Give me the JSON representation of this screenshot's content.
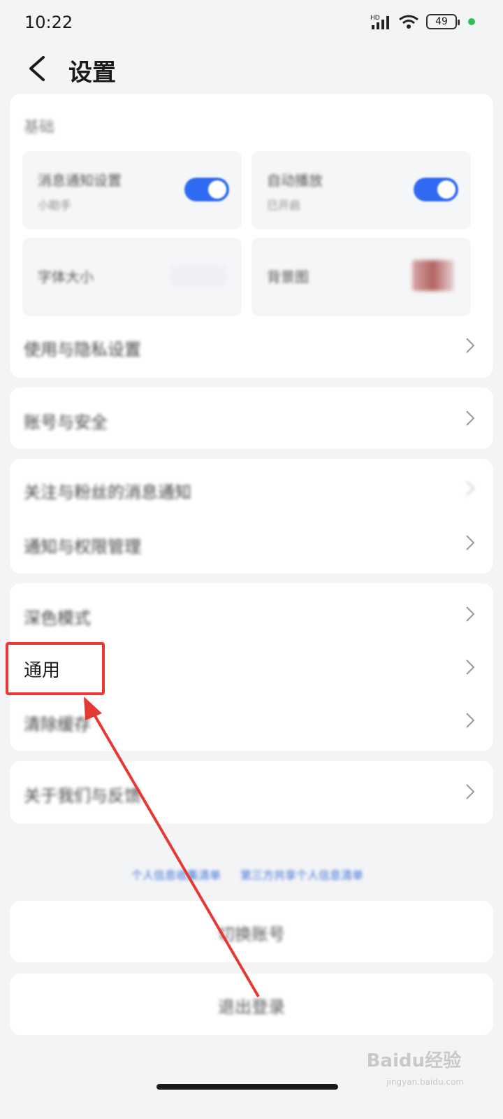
{
  "status": {
    "time": "10:22",
    "battery": "49",
    "network": "HD"
  },
  "header": {
    "title": "设置"
  },
  "card1": {
    "title": "基础",
    "tiles": [
      {
        "label": "消息通知设置",
        "sub": "小助手"
      },
      {
        "label": "自动播放",
        "sub": "已开启"
      },
      {
        "label": "字体大小"
      },
      {
        "label": "背景图"
      }
    ],
    "row": "使用与隐私设置"
  },
  "card2": {
    "row": "账号与安全"
  },
  "card3": {
    "rows": [
      "关注与粉丝的消息通知",
      "通知与权限管理"
    ]
  },
  "card4": {
    "rows": [
      "深色模式",
      "通用",
      "清除缓存"
    ]
  },
  "card5": {
    "row": "关于我们与反馈"
  },
  "links": {
    "left": "个人信息收集清单",
    "right": "第三方共享个人信息清单"
  },
  "buttons": {
    "switch": "切换账号",
    "logout": "退出登录"
  },
  "watermark": {
    "main": "Baidu经验",
    "sub": "jingyan.baidu.com"
  }
}
